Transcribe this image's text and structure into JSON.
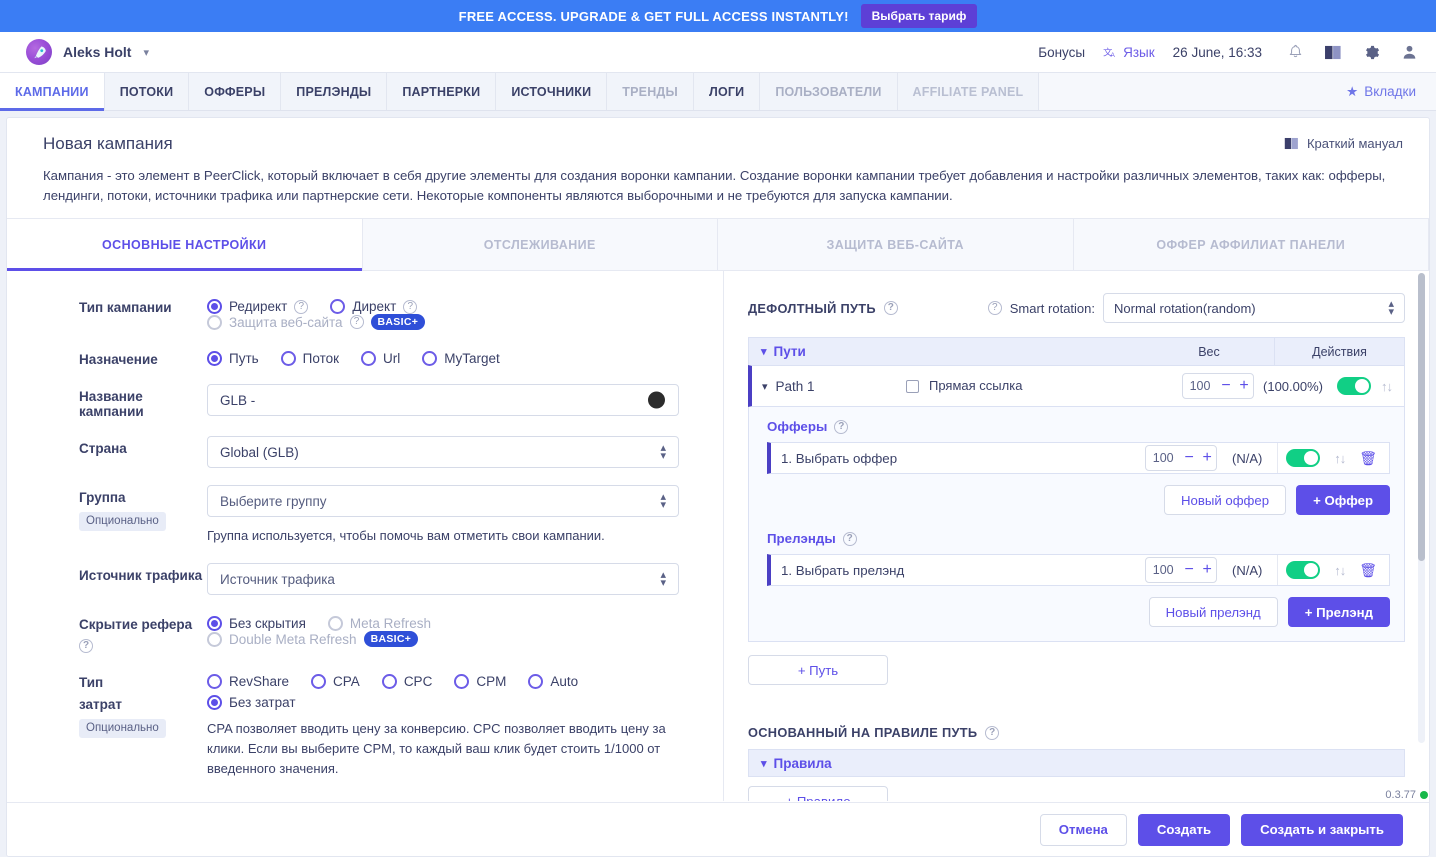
{
  "promo": {
    "text": "FREE ACCESS. UPGRADE & GET FULL ACCESS INSTANTLY!",
    "button": "Выбрать тариф"
  },
  "header": {
    "brand": "Aleks Holt",
    "bonuses": "Бонусы",
    "language": "Язык",
    "datetime": "26 June, 16:33",
    "icons": [
      "bell-icon",
      "book-icon",
      "gear-icon",
      "user-icon"
    ]
  },
  "tabs": [
    {
      "label": "КАМПАНИИ",
      "state": "active"
    },
    {
      "label": "ПОТОКИ",
      "state": "normal"
    },
    {
      "label": "ОФФЕРЫ",
      "state": "normal"
    },
    {
      "label": "ПРЕЛЭНДЫ",
      "state": "normal"
    },
    {
      "label": "ПАРТНЕРКИ",
      "state": "normal"
    },
    {
      "label": "ИСТОЧНИКИ",
      "state": "normal"
    },
    {
      "label": "ТРЕНДЫ",
      "state": "dim"
    },
    {
      "label": "ЛОГИ",
      "state": "normal"
    },
    {
      "label": "ПОЛЬЗОВАТЕЛИ",
      "state": "dim"
    },
    {
      "label": "AFFILIATE PANEL",
      "state": "faded"
    }
  ],
  "tabs_right_label": "Вкладки",
  "page": {
    "title": "Новая кампания",
    "manual_label": "Краткий мануал",
    "description": "Кампания - это элемент в PeerClick, который включает в себя другие элементы для создания воронки кампании. Создание воронки кампании требует добавления и настройки различных элементов, таких как: офферы, лендинги, потоки, источники трафика или партнерские сети. Некоторые компоненты являются выборочными и не требуются для запуска кампании."
  },
  "subtabs": [
    {
      "label": "ОСНОВНЫЕ НАСТРОЙКИ",
      "active": true
    },
    {
      "label": "ОТСЛЕЖИВАНИЕ",
      "active": false
    },
    {
      "label": "ЗАЩИТА ВЕБ-САЙТА",
      "active": false
    },
    {
      "label": "ОФФЕР АФФИЛИАТ ПАНЕЛИ",
      "active": false
    }
  ],
  "form": {
    "campaign_type": {
      "label": "Тип кампании",
      "options": [
        {
          "label": "Редирект",
          "selected": true,
          "disabled": false,
          "help": true
        },
        {
          "label": "Директ",
          "selected": false,
          "disabled": false,
          "help": true
        },
        {
          "label": "Защита веб-сайта",
          "selected": false,
          "disabled": true,
          "help": true
        }
      ],
      "badge": "BASIC+"
    },
    "destination": {
      "label": "Назначение",
      "options": [
        {
          "label": "Путь",
          "selected": true
        },
        {
          "label": "Поток",
          "selected": false
        },
        {
          "label": "Url",
          "selected": false
        },
        {
          "label": "MyTarget",
          "selected": false
        }
      ]
    },
    "campaign_name": {
      "label": "Название кампании",
      "value": "GLB -",
      "color": "#2c2c2c"
    },
    "country": {
      "label": "Страна",
      "value": "Global (GLB)"
    },
    "group": {
      "label": "Группа",
      "badge": "Опционально",
      "placeholder": "Выберите группу",
      "hint": "Группа используется, чтобы помочь вам отметить свои кампании."
    },
    "traffic_source": {
      "label": "Источник трафика",
      "placeholder": "Источник трафика"
    },
    "referrer_hiding": {
      "label": "Скрытие рефера",
      "options": [
        {
          "label": "Без скрытия",
          "selected": true,
          "disabled": false
        },
        {
          "label": "Meta Refresh",
          "selected": false,
          "disabled": true
        },
        {
          "label": "Double Meta Refresh",
          "selected": false,
          "disabled": true
        }
      ],
      "badge": "BASIC+"
    },
    "cost_type": {
      "label_line1": "Тип",
      "label_line2": "затрат",
      "badge": "Опционально",
      "options": [
        {
          "label": "RevShare",
          "selected": false
        },
        {
          "label": "CPA",
          "selected": false
        },
        {
          "label": "CPC",
          "selected": false
        },
        {
          "label": "CPM",
          "selected": false
        },
        {
          "label": "Auto",
          "selected": false
        },
        {
          "label": "Без затрат",
          "selected": true
        }
      ],
      "hint": "CPA позволяет вводить цену за конверсию. CPC позволяет вводить цену за клики. Если вы выберите CPM, то каждый ваш клик будет стоить 1/1000 от введенного значения."
    }
  },
  "right": {
    "default_path_title": "ДЕФОЛТНЫЙ ПУТЬ",
    "smart_rotation_label": "Smart rotation:",
    "smart_rotation_value": "Normal rotation(random)",
    "table_head": {
      "paths": "Пути",
      "weight": "Вес",
      "actions": "Действия"
    },
    "path": {
      "name": "Path 1",
      "direct_link": "Прямая ссылка",
      "weight": "100",
      "percent": "(100.00%)",
      "enabled": true
    },
    "offers": {
      "title": "Офферы",
      "items": [
        {
          "name": "1. Выбрать оффер",
          "weight": "100",
          "percent": "(N/A)",
          "enabled": true
        }
      ],
      "new_button": "Новый оффер",
      "add_button": "+ Оффер"
    },
    "prelands": {
      "title": "Прелэнды",
      "items": [
        {
          "name": "1. Выбрать прелэнд",
          "weight": "100",
          "percent": "(N/A)",
          "enabled": true
        }
      ],
      "new_button": "Новый прелэнд",
      "add_button": "+ Прелэнд"
    },
    "add_path_button": "+ Путь",
    "rule_path_title": "ОСНОВАННЫЙ НА ПРАВИЛЕ ПУТЬ",
    "rules_label": "Правила",
    "add_rule_button": "+ Правило"
  },
  "footer": {
    "cancel": "Отмена",
    "create": "Создать",
    "create_close": "Создать и закрыть",
    "version": "0.3.77"
  },
  "colors": {
    "accent": "#5d4fe8",
    "promo_bg": "#3b7df4",
    "toggle_on": "#11cf85",
    "badge_basic": "#2f4fd8"
  }
}
